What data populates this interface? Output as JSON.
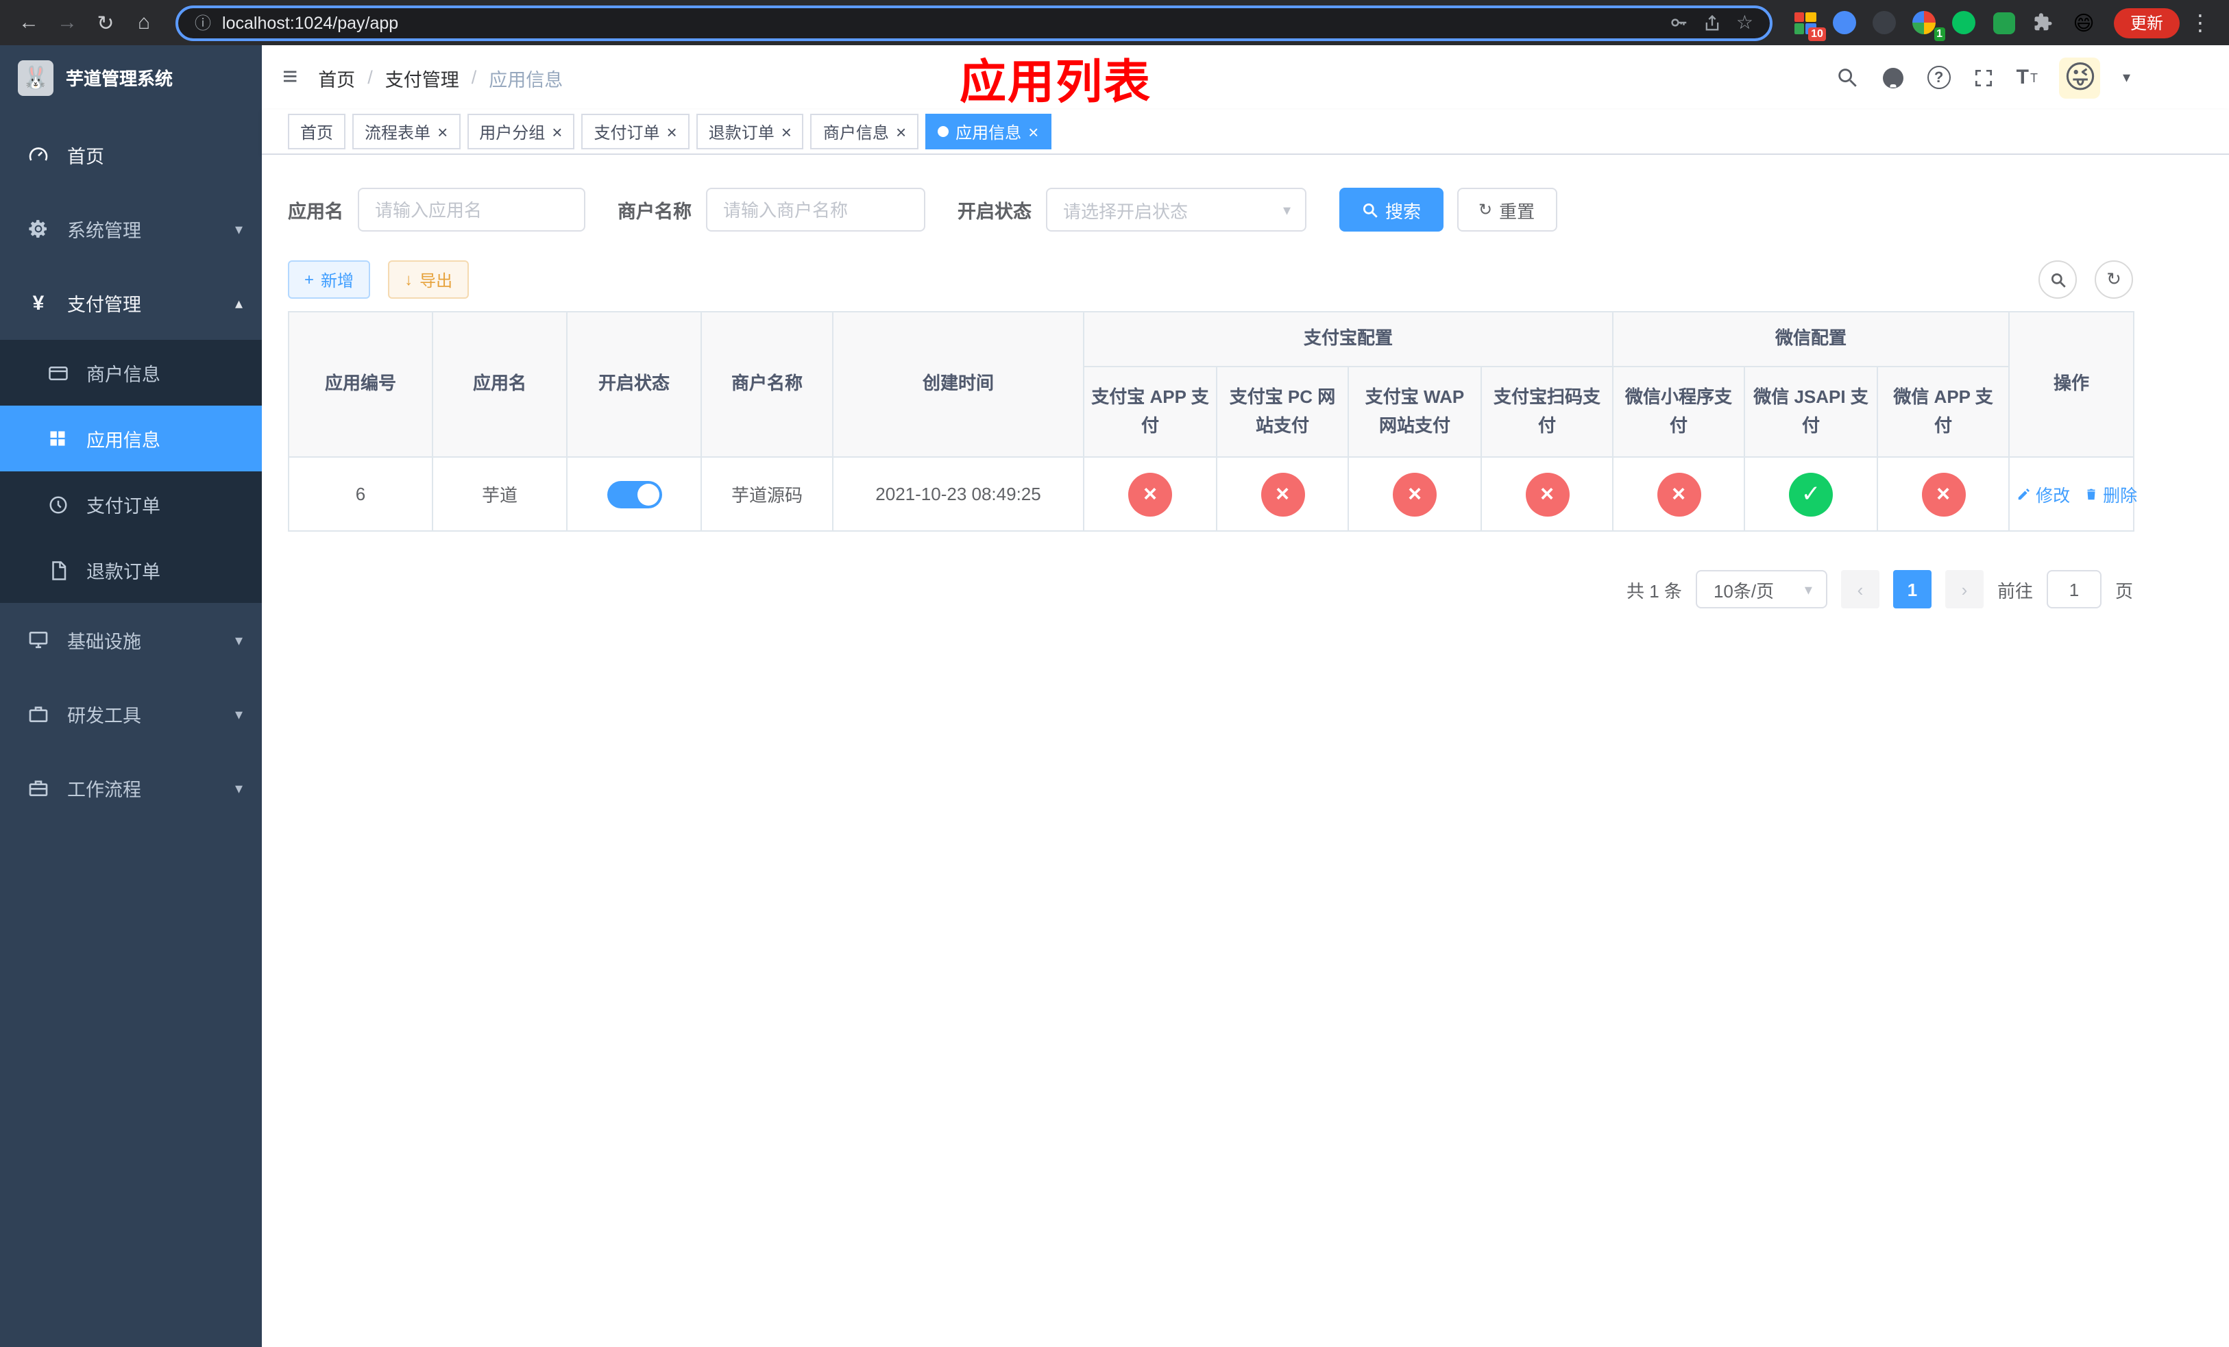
{
  "browser": {
    "url": "localhost:1024/pay/app",
    "update_button": "更新",
    "ext_badges": [
      "10",
      "1"
    ]
  },
  "icons": {
    "back": "←",
    "forward": "→",
    "reload": "↻",
    "home": "⌂",
    "info": "ⓘ",
    "star": "☆",
    "menu_dots": "⋮",
    "hamburger": "≡",
    "chevron_down": "▾",
    "chevron_up": "▴",
    "question": "?",
    "close": "×",
    "check": "✓",
    "cross": "×",
    "plus": "+",
    "download": "↓",
    "refresh": "↻",
    "prev": "‹",
    "next": "›",
    "yen": "¥",
    "font_large": "T",
    "font_small": "T",
    "logo_emoji": "🐰",
    "avatar_emoji": "😜",
    "profile_emoji": "😄"
  },
  "sidebar": {
    "title": "芋道管理系统",
    "menu_home": "首页",
    "menu_system": "系统管理",
    "menu_pay": "支付管理",
    "menu_infra": "基础设施",
    "menu_dev": "研发工具",
    "menu_flow": "工作流程",
    "sub_merchant": "商户信息",
    "sub_app": "应用信息",
    "sub_order": "支付订单",
    "sub_refund": "退款订单"
  },
  "header": {
    "breadcrumb": [
      "首页",
      "支付管理",
      "应用信息"
    ],
    "separator": "/",
    "overlay_title": "应用列表"
  },
  "tabs": [
    {
      "label": "首页"
    },
    {
      "label": "流程表单"
    },
    {
      "label": "用户分组"
    },
    {
      "label": "支付订单"
    },
    {
      "label": "退款订单"
    },
    {
      "label": "商户信息"
    },
    {
      "label": "应用信息"
    }
  ],
  "filters": {
    "app_name_label": "应用名",
    "app_name_placeholder": "请输入应用名",
    "merchant_label": "商户名称",
    "merchant_placeholder": "请输入商户名称",
    "status_label": "开启状态",
    "status_placeholder": "请选择开启状态",
    "search_button": "搜索",
    "reset_button": "重置"
  },
  "toolbar": {
    "add_button": "新增",
    "export_button": "导出"
  },
  "table": {
    "group_alipay": "支付宝配置",
    "group_wechat": "微信配置",
    "columns": {
      "app_id": "应用编号",
      "app_name": "应用名",
      "status": "开启状态",
      "merchant": "商户名称",
      "created": "创建时间",
      "alipay_app": "支付宝 APP 支付",
      "alipay_pc": "支付宝 PC 网站支付",
      "alipay_wap": "支付宝 WAP 网站支付",
      "alipay_qr": "支付宝扫码支付",
      "wx_lite": "微信小程序支付",
      "wx_jsapi": "微信 JSAPI 支付",
      "wx_app": "微信 APP 支付",
      "actions": "操作"
    },
    "row": {
      "app_id": "6",
      "app_name": "芋道",
      "enabled": true,
      "merchant": "芋道源码",
      "created": "2021-10-23 08:49:25",
      "alipay_app": false,
      "alipay_pc": false,
      "alipay_wap": false,
      "alipay_qr": false,
      "wx_lite": false,
      "wx_jsapi": true,
      "wx_app": false,
      "edit": "修改",
      "delete": "删除"
    }
  },
  "pagination": {
    "total": "共 1 条",
    "page_size": "10条/页",
    "page": "1",
    "goto": "前往",
    "goto_value": "1",
    "unit": "页"
  },
  "colors": {
    "primary": "#409eff",
    "danger": "#f56c6c",
    "success": "#13ce66",
    "warning": "#e6a23c",
    "sidebar_bg": "#304156",
    "submenu_bg": "#1f2d3d",
    "overlay_red": "#ff0000"
  }
}
